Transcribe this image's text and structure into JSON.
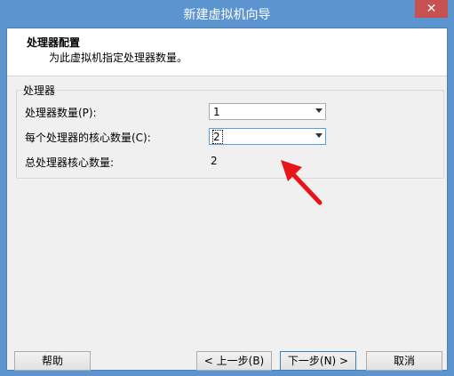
{
  "window": {
    "title": "新建虚拟机向导",
    "close_glyph": "✕"
  },
  "header": {
    "title": "处理器配置",
    "subtitle": "为此虚拟机指定处理器数量。"
  },
  "processor_group": {
    "label": "处理器",
    "processor_count_label": "处理器数量(P):",
    "processor_count_value": "1",
    "cores_per_processor_label": "每个处理器的核心数量(C):",
    "cores_per_processor_value": "2",
    "total_cores_label": "总处理器核心数量:",
    "total_cores_value": "2"
  },
  "buttons": {
    "help": "帮助",
    "back": "< 上一步(B)",
    "next": "下一步(N) >",
    "cancel": "取消"
  },
  "colors": {
    "titlebar": "#5c94cf",
    "close": "#c75050",
    "annotation_arrow": "#e8141a"
  },
  "icons": {
    "close": "close-icon",
    "dropdown": "chevron-down-icon",
    "annotation": "red-arrow-icon"
  }
}
